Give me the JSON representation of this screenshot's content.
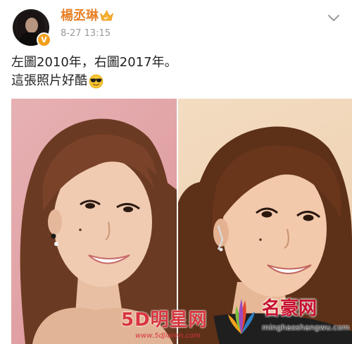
{
  "post": {
    "author": {
      "name": "楊丞琳",
      "verified_badge_symbol": "V",
      "verified_color": "#f29f1e",
      "name_color": "#e8822a"
    },
    "timestamp": "8-27 13:15",
    "text_lines": [
      "左圖2010年，右圖2017年。",
      "這張照片好酷"
    ],
    "icons": {
      "vip": "vip-crown-icon",
      "emoji": "cool-sunglasses-emoji-icon",
      "more": "chevron-down-icon"
    },
    "photo": {
      "left_caption": "",
      "right_caption": ""
    },
    "watermarks": {
      "left_main": "5D明星网",
      "left_sub": "www.5dJiaren.com",
      "right_main": "名豪网",
      "right_sub": "minghaoshangwu.com"
    }
  }
}
